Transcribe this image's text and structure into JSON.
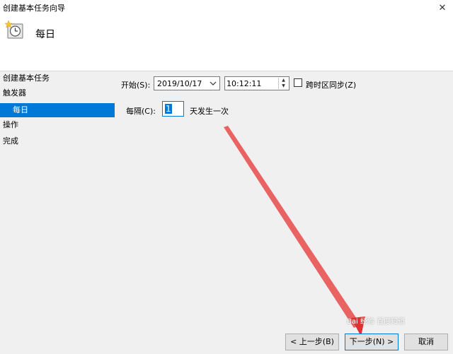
{
  "window": {
    "title": "创建基本任务向导"
  },
  "header": {
    "title": "每日"
  },
  "sidebar": {
    "items": [
      {
        "label": "创建基本任务"
      },
      {
        "label": "触发器"
      },
      {
        "label": "每日"
      },
      {
        "label": "操作"
      },
      {
        "label": "完成"
      }
    ]
  },
  "form": {
    "start_label": "开始(S):",
    "date_value": "2019/10/17",
    "time_value": "10:12:11",
    "sync_label": "跨时区同步(Z)",
    "sync_checked": false,
    "interval_label": "每隔(C):",
    "interval_value": "1",
    "interval_suffix": "天发生一次"
  },
  "buttons": {
    "back": "< 上一步(B)",
    "next": "下一步(N) >",
    "cancel": "取消"
  },
  "watermark": "Bai 经验 百度知道"
}
